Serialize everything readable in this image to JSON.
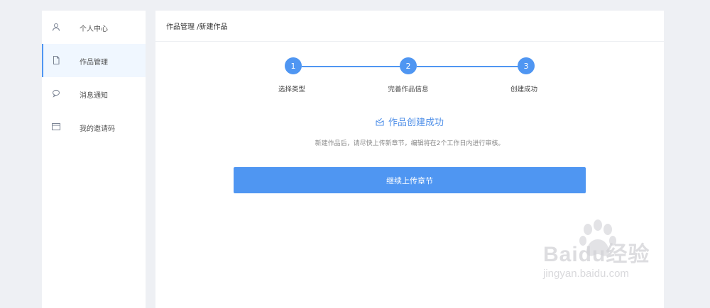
{
  "sidebar": {
    "items": [
      {
        "label": "个人中心",
        "icon": "user-icon"
      },
      {
        "label": "作品管理",
        "icon": "document-icon",
        "active": true
      },
      {
        "label": "消息通知",
        "icon": "chat-icon"
      },
      {
        "label": "我的邀请码",
        "icon": "card-icon"
      }
    ]
  },
  "main": {
    "breadcrumb": "作品管理 /新建作品",
    "steps": [
      {
        "number": "1",
        "label": "选择类型"
      },
      {
        "number": "2",
        "label": "完善作品信息"
      },
      {
        "number": "3",
        "label": "创建成功"
      }
    ],
    "success_title": "作品创建成功",
    "success_desc": "新建作品后，请尽快上传新章节，编辑将在2个工作日内进行审核。",
    "continue_button": "继续上传章节"
  },
  "watermark": {
    "main": "Baidu经验",
    "sub": "jingyan.baidu.com"
  },
  "colors": {
    "accent": "#4f96f2",
    "background": "#eef0f4",
    "active_item_bg": "#f0f7ff"
  }
}
